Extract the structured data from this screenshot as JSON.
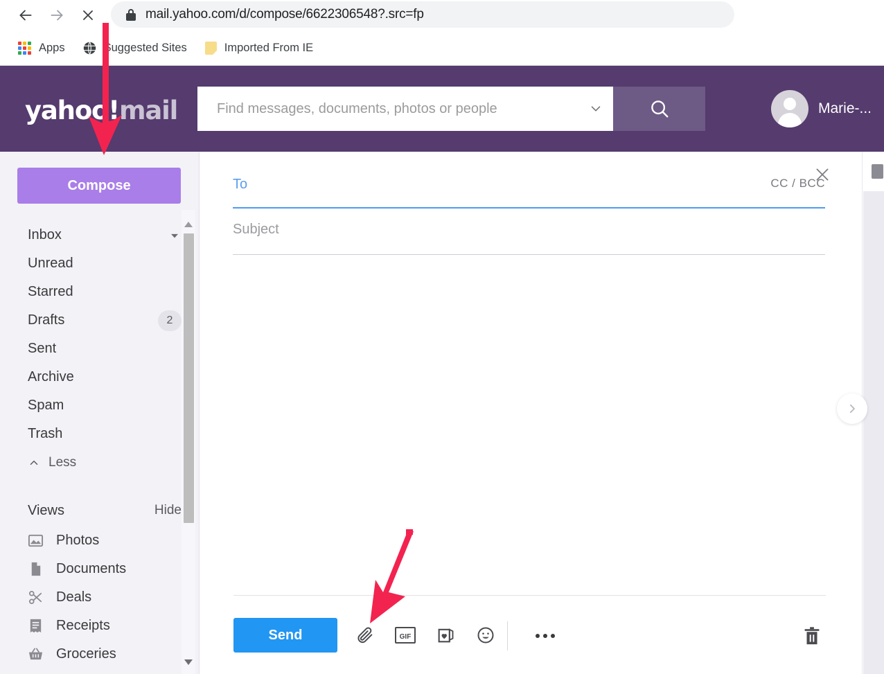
{
  "browser": {
    "back_icon": "arrow-left-icon",
    "forward_icon": "arrow-right-icon",
    "stop_icon": "close-x-icon",
    "lock_icon": "lock-icon",
    "url": "mail.yahoo.com/d/compose/6622306548?.src=fp",
    "bookmarks": [
      {
        "label": "Apps",
        "icon": "apps-grid-icon"
      },
      {
        "label": "Suggested Sites",
        "icon": "globe-icon"
      },
      {
        "label": "Imported From IE",
        "icon": "folder-icon"
      }
    ]
  },
  "header": {
    "logo": {
      "yahoo": "yahoo",
      "bang": "!",
      "mail": "mail"
    },
    "search": {
      "placeholder": "Find messages, documents, photos or people",
      "value": "",
      "chevron_icon": "chevron-down-icon",
      "search_icon": "search-icon"
    },
    "account": {
      "name": "Marie-...",
      "avatar_icon": "person-avatar-icon"
    },
    "colors": {
      "header_bg": "#553b6e",
      "search_button_bg": "#6d5a85"
    }
  },
  "sidebar": {
    "compose_label": "Compose",
    "compose_color": "#a97ee8",
    "folders": [
      {
        "label": "Inbox",
        "badge": "",
        "caret": "chevron-down-icon"
      },
      {
        "label": "Unread",
        "badge": "",
        "caret": ""
      },
      {
        "label": "Starred",
        "badge": "",
        "caret": ""
      },
      {
        "label": "Drafts",
        "badge": "2",
        "caret": ""
      },
      {
        "label": "Sent",
        "badge": "",
        "caret": ""
      },
      {
        "label": "Archive",
        "badge": "",
        "caret": ""
      },
      {
        "label": "Spam",
        "badge": "",
        "caret": ""
      },
      {
        "label": "Trash",
        "badge": "",
        "caret": ""
      }
    ],
    "less_label": "Less",
    "less_icon": "chevron-up-icon",
    "views": {
      "title": "Views",
      "hide_label": "Hide",
      "items": [
        {
          "label": "Photos",
          "icon": "photo-icon"
        },
        {
          "label": "Documents",
          "icon": "document-icon"
        },
        {
          "label": "Deals",
          "icon": "scissors-icon"
        },
        {
          "label": "Receipts",
          "icon": "receipt-icon"
        },
        {
          "label": "Groceries",
          "icon": "basket-icon"
        }
      ]
    },
    "scrollbar": {
      "up_icon": "scroll-up-arrow-icon",
      "down_icon": "scroll-down-arrow-icon"
    }
  },
  "compose": {
    "close_icon": "close-icon",
    "to": {
      "label": "To",
      "value": "",
      "cc_bcc_label": "CC / BCC"
    },
    "subject": {
      "label": "Subject",
      "value": ""
    },
    "body": {
      "value": ""
    },
    "footer": {
      "send_label": "Send",
      "send_color": "#2196f3",
      "tools": [
        {
          "name": "attach-file",
          "icon": "paperclip-icon"
        },
        {
          "name": "insert-gif",
          "icon": "gif-icon",
          "text": "GIF"
        },
        {
          "name": "greeting-card",
          "icon": "greeting-card-icon"
        },
        {
          "name": "insert-emoji",
          "icon": "smiley-icon"
        }
      ],
      "more_icon": "more-horizontal-icon",
      "delete_icon": "trash-icon"
    }
  },
  "right_rail": {
    "top_icon": "app-panel-icon",
    "expand_icon": "chevron-right-icon"
  },
  "annotations": {
    "arrow_color": "#f3234f",
    "arrows": [
      {
        "name": "arrow-to-compose-button",
        "points_to": "Compose"
      },
      {
        "name": "arrow-to-attach-file-button",
        "points_to": "paperclip-icon"
      }
    ]
  }
}
